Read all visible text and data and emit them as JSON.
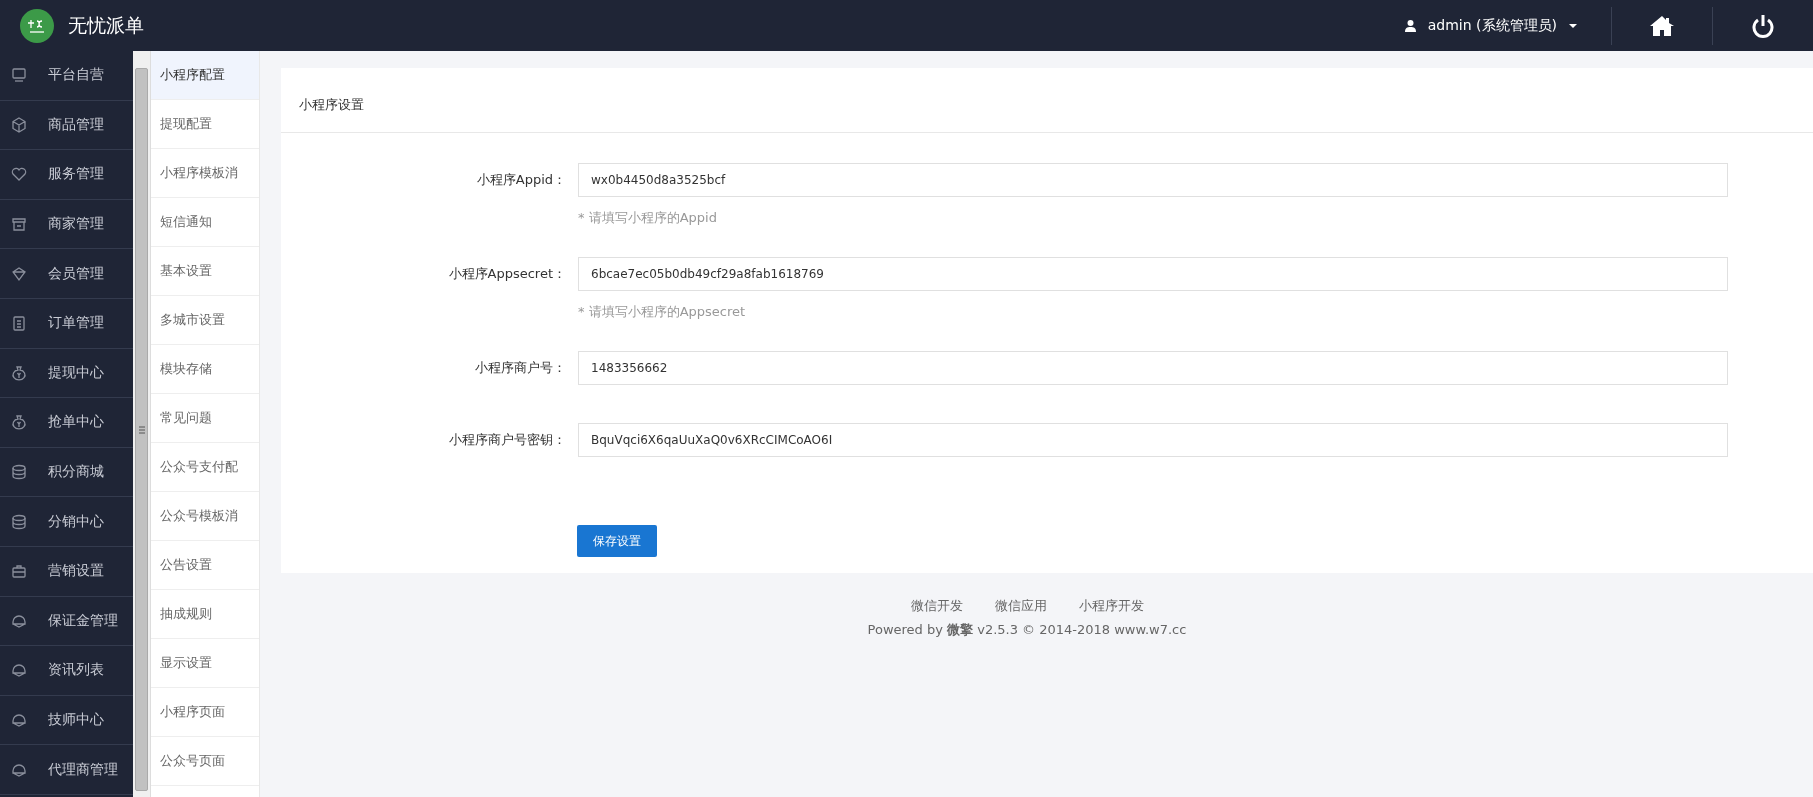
{
  "header": {
    "title": "无忧派单",
    "user": "admin (系统管理员)"
  },
  "sidebar": {
    "items": [
      {
        "label": "平台自营"
      },
      {
        "label": "商品管理"
      },
      {
        "label": "服务管理"
      },
      {
        "label": "商家管理"
      },
      {
        "label": "会员管理"
      },
      {
        "label": "订单管理"
      },
      {
        "label": "提现中心"
      },
      {
        "label": "抢单中心"
      },
      {
        "label": "积分商城"
      },
      {
        "label": "分销中心"
      },
      {
        "label": "营销设置"
      },
      {
        "label": "保证金管理"
      },
      {
        "label": "资讯列表"
      },
      {
        "label": "技师中心"
      },
      {
        "label": "代理商管理"
      }
    ]
  },
  "submenu": {
    "items": [
      {
        "label": "小程序配置",
        "selected": true
      },
      {
        "label": "提现配置",
        "selected": false
      },
      {
        "label": "小程序模板消",
        "selected": false
      },
      {
        "label": "短信通知",
        "selected": false
      },
      {
        "label": "基本设置",
        "selected": false
      },
      {
        "label": "多城市设置",
        "selected": false
      },
      {
        "label": "模块存储",
        "selected": false
      },
      {
        "label": "常见问题",
        "selected": false
      },
      {
        "label": "公众号支付配",
        "selected": false
      },
      {
        "label": "公众号模板消",
        "selected": false
      },
      {
        "label": "公告设置",
        "selected": false
      },
      {
        "label": "抽成规则",
        "selected": false
      },
      {
        "label": "显示设置",
        "selected": false
      },
      {
        "label": "小程序页面",
        "selected": false
      },
      {
        "label": "公众号页面",
        "selected": false
      }
    ]
  },
  "panel": {
    "title": "小程序设置",
    "fields": [
      {
        "label": "小程序Appid：",
        "value": "wx0b4450d8a3525bcf",
        "help": "* 请填写小程序的Appid"
      },
      {
        "label": "小程序Appsecret：",
        "value": "6bcae7ec05b0db49cf29a8fab1618769",
        "help": "* 请填写小程序的Appsecret"
      },
      {
        "label": "小程序商户号：",
        "value": "1483356662"
      },
      {
        "label": "小程序商户号密钥：",
        "value": "BquVqci6X6qaUuXaQ0v6XRcCIMCoAO6I"
      }
    ],
    "save_button": "保存设置"
  },
  "footer": {
    "links": [
      "微信开发",
      "微信应用",
      "小程序开发"
    ],
    "powered": "Powered by **微擎** v2.5.3 © 2014-2018 www.w7.cc"
  }
}
